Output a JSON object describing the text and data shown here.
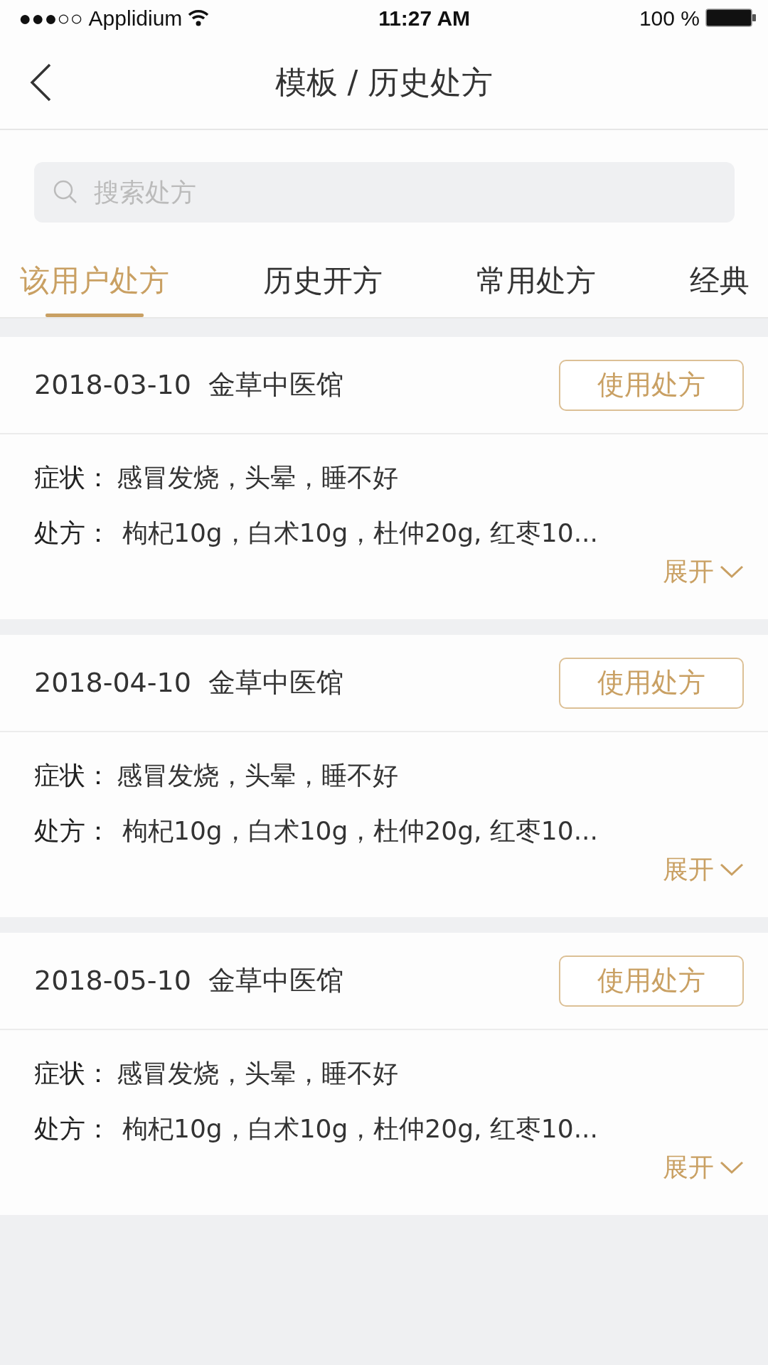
{
  "status_bar": {
    "signal": "●●●○○",
    "carrier": "Applidium",
    "time": "11:27 AM",
    "battery": "100 %"
  },
  "nav": {
    "title": "模板 / 历史处方"
  },
  "search": {
    "placeholder": "搜索处方"
  },
  "tabs": [
    {
      "label": "该用户处方",
      "selected": true
    },
    {
      "label": "历史开方",
      "selected": false
    },
    {
      "label": "常用处方",
      "selected": false
    },
    {
      "label": "经典",
      "selected": false
    }
  ],
  "records": [
    {
      "date": "2018-03-10",
      "clinic": "金草中医馆",
      "button": "使用处方",
      "symptom_label": "症状：",
      "symptom": "感冒发烧，头晕，睡不好",
      "prescription_label": "处方：",
      "prescription": "枸杞10g，白术10g，杜仲20g, 红枣10...",
      "expand": "展开"
    },
    {
      "date": "2018-04-10",
      "clinic": "金草中医馆",
      "button": "使用处方",
      "symptom_label": "症状：",
      "symptom": "感冒发烧，头晕，睡不好",
      "prescription_label": "处方：",
      "prescription": "枸杞10g，白术10g，杜仲20g, 红枣10...",
      "expand": "展开"
    },
    {
      "date": "2018-05-10",
      "clinic": "金草中医馆",
      "button": "使用处方",
      "symptom_label": "症状：",
      "symptom": "感冒发烧，头晕，睡不好",
      "prescription_label": "处方：",
      "prescription": "枸杞10g，白术10g，杜仲20g, 红枣10...",
      "expand": "展开"
    }
  ]
}
